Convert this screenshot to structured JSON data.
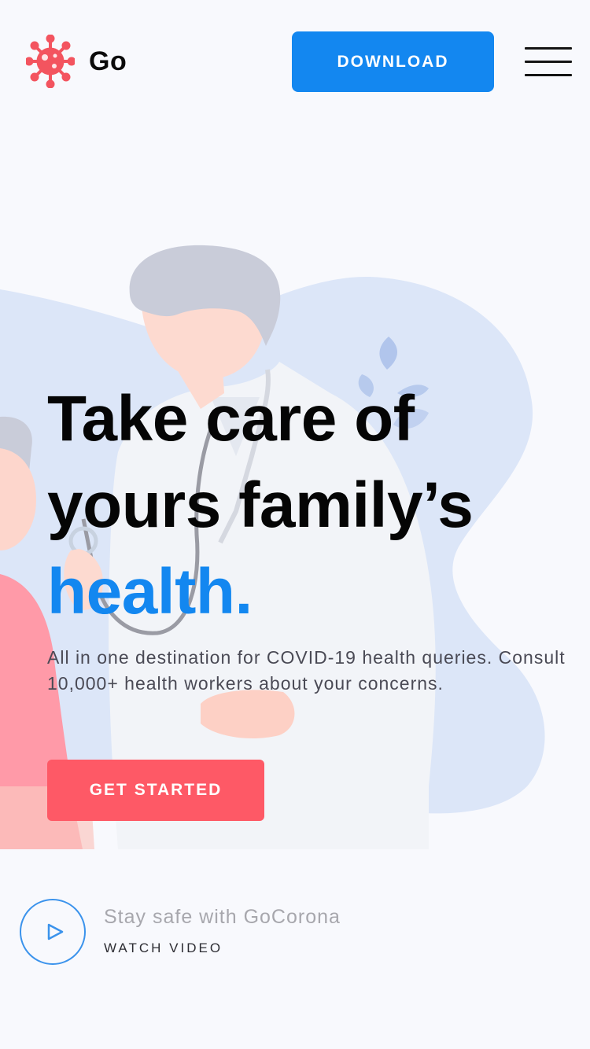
{
  "header": {
    "logo_text": "Go",
    "logo_icon": "virus-icon",
    "download_label": "DOWNLOAD",
    "menu_icon": "hamburger-menu-icon"
  },
  "hero": {
    "title_line1": "Take care of",
    "title_line2": "yours family’s",
    "title_highlight": "health.",
    "description": "All in one destination for COVID-19 health queries. Consult 10,000+ health workers about your concerns.",
    "cta_label": "GET STARTED",
    "illustration": "doctor-and-patient-illustration"
  },
  "video": {
    "title": "Stay safe with GoCorona",
    "link_label": "WATCH VIDEO",
    "play_icon": "play-icon"
  },
  "colors": {
    "background": "#f8f9fd",
    "primary_blue": "#1387f0",
    "accent_red": "#fe5966",
    "heading": "#050505",
    "body_text": "#4a4a55",
    "muted_text": "#a7a7ad",
    "logo_red": "#f3545f"
  }
}
